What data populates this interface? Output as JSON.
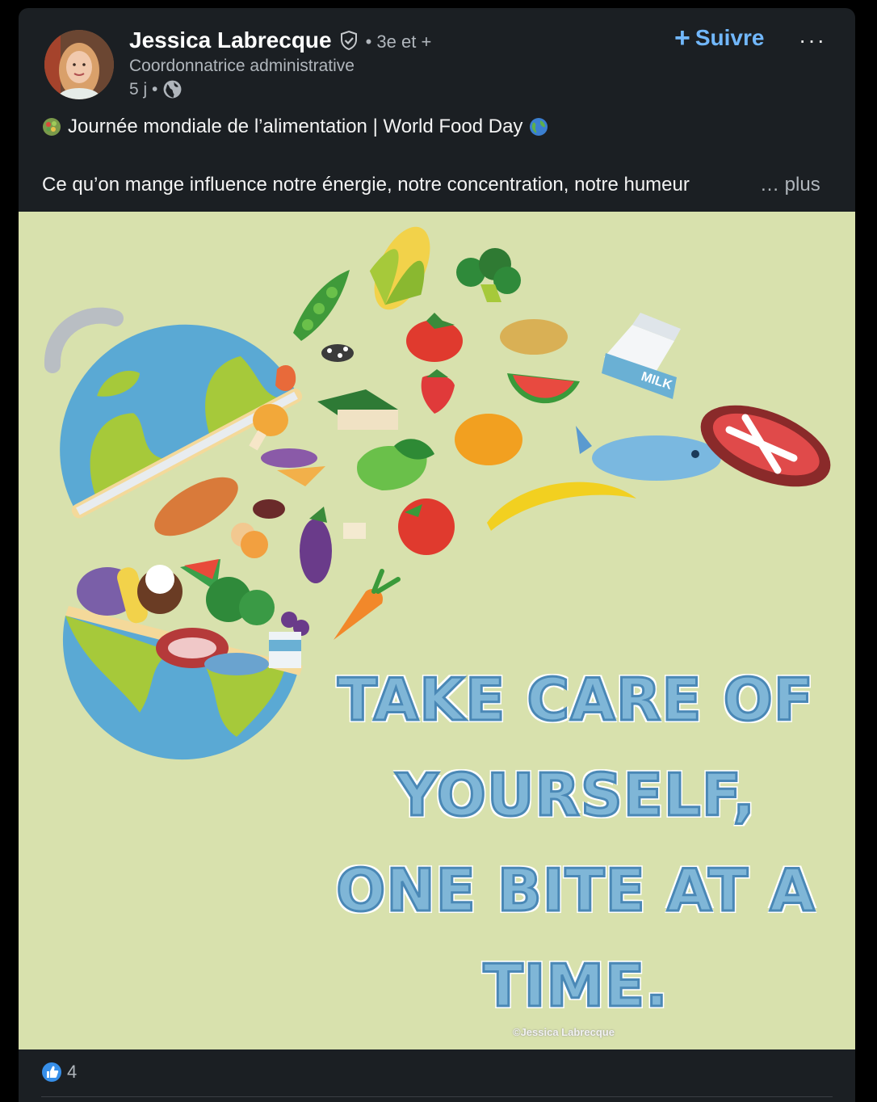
{
  "author": {
    "name": "Jessica Labrecque",
    "degree": "• 3e et +",
    "title": "Coordonnatrice administrative",
    "time": "5 j •"
  },
  "actions": {
    "follow_label": "Suivre",
    "more_label": "···"
  },
  "post": {
    "line1": "Journée mondiale de l’alimentation | World Food Day",
    "line2": "Ce qu’on mange influence notre énergie, notre concentration, notre humeur",
    "more_link": "… plus"
  },
  "image": {
    "slogan_lines": [
      "TAKE CARE OF",
      "YOURSELF,",
      "ONE BITE AT A",
      "TIME."
    ],
    "milk_label": "MILK",
    "watermark": "©Jessica Labrecque"
  },
  "reactions": {
    "count": "4"
  },
  "colors": {
    "card_bg": "#1b1f23",
    "image_bg": "#d8e1ad",
    "accent": "#71b7fb",
    "slogan": "#7fb6d7"
  },
  "icons": [
    "verified-shield-icon",
    "globe-icon",
    "salad-emoji-icon",
    "earth-emoji-icon",
    "like-reaction-icon",
    "more-options-icon",
    "plus-icon"
  ]
}
